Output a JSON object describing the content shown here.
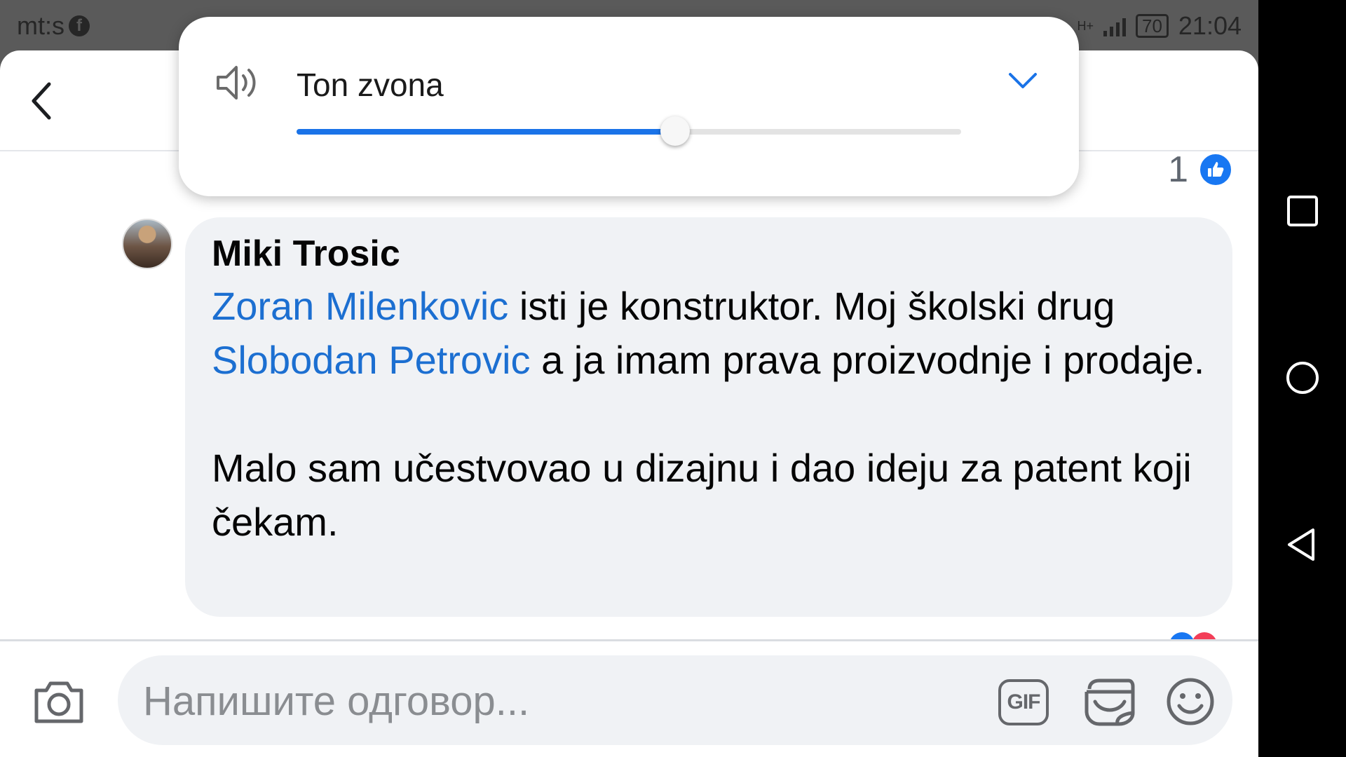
{
  "status_bar": {
    "carrier": "mt:s",
    "network_type": "H+",
    "battery": "70",
    "time": "21:04"
  },
  "volume_panel": {
    "label": "Ton zvona",
    "level_fraction": 0.57
  },
  "likes": {
    "count": "1"
  },
  "comment": {
    "author": "Miki Trosic",
    "mention_1": "Zoran Milenkovic",
    "text_1": " isti je konstruktor. Moj školski drug ",
    "mention_2": "Slobodan Petrovic",
    "text_2": " a ja imam prava proizvodnje i prodaje.",
    "paragraph_2": "Malo sam učestvovao u dizajnu i dao ideju za patent koji čekam."
  },
  "composer": {
    "placeholder": "Напишите одговор...",
    "gif_label": "GIF"
  },
  "colors": {
    "facebook_blue": "#1877f2",
    "mention_blue": "#1c6fd1",
    "slider_blue": "#1a73e8",
    "bubble_bg": "#f0f2f5"
  },
  "icons": [
    "facebook-icon",
    "signal-icon",
    "battery-icon",
    "back-arrow-icon",
    "speaker-icon",
    "chevron-down-icon",
    "thumbs-up-icon",
    "camera-icon",
    "sticker-icon",
    "emoji-icon",
    "recents-square-icon",
    "home-circle-icon",
    "back-triangle-icon"
  ]
}
